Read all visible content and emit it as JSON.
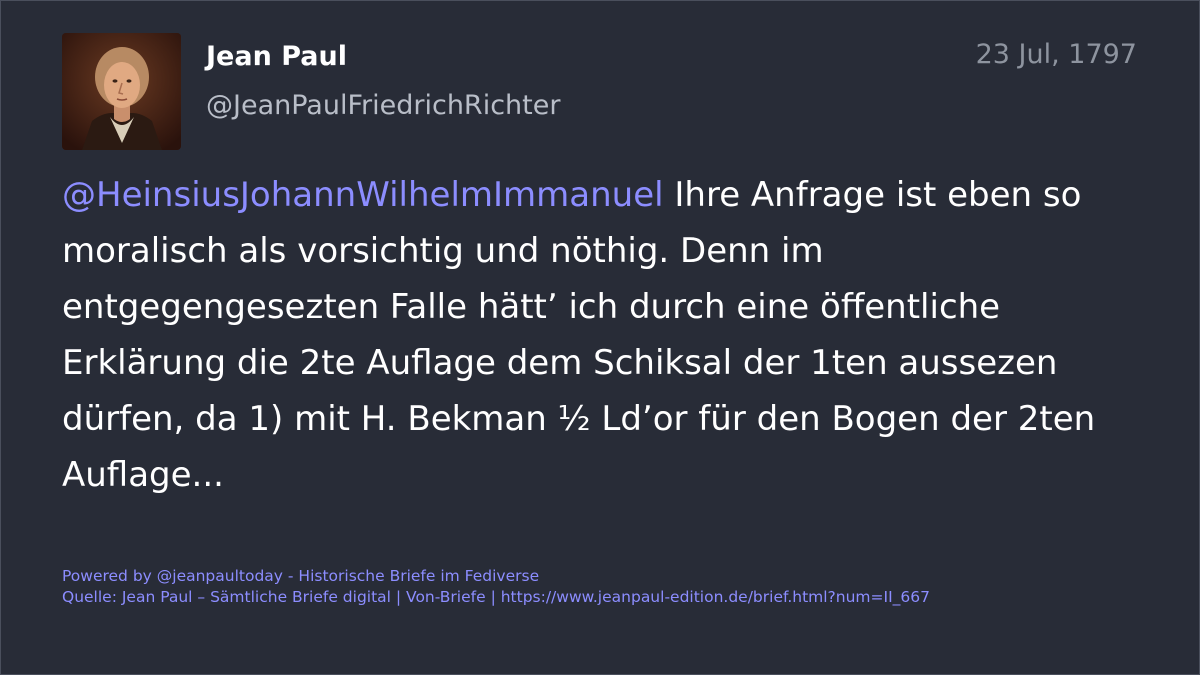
{
  "author": {
    "name": "Jean Paul",
    "handle": "@JeanPaulFriedrichRichter",
    "avatar_icon": "portrait-avatar"
  },
  "post": {
    "date": "23 Jul, 1797",
    "mention": "@HeinsiusJohannWilhelmImmanuel",
    "text": " Ihre Anfrage ist eben so moralisch als vorsichtig und nöthig. Denn im entgegengesezten Falle hätt’ ich durch eine öffentliche Erklärung die 2te Auflage dem Schiksal der 1ten aussezen dürfen, da 1) mit H. Bekman ½ Ld’or für den Bogen der 2ten Auflage..."
  },
  "footer": {
    "powered_by": "Powered by @jeanpaultoday - Historische Briefe im Fediverse",
    "source": "Quelle: Jean Paul – Sämtliche Briefe digital | Von-Briefe | https://www.jeanpaul-edition.de/brief.html?num=II_667"
  },
  "colors": {
    "background": "#282c37",
    "mention": "#8c8dff",
    "text": "#ffffff",
    "muted": "#8e949f"
  }
}
